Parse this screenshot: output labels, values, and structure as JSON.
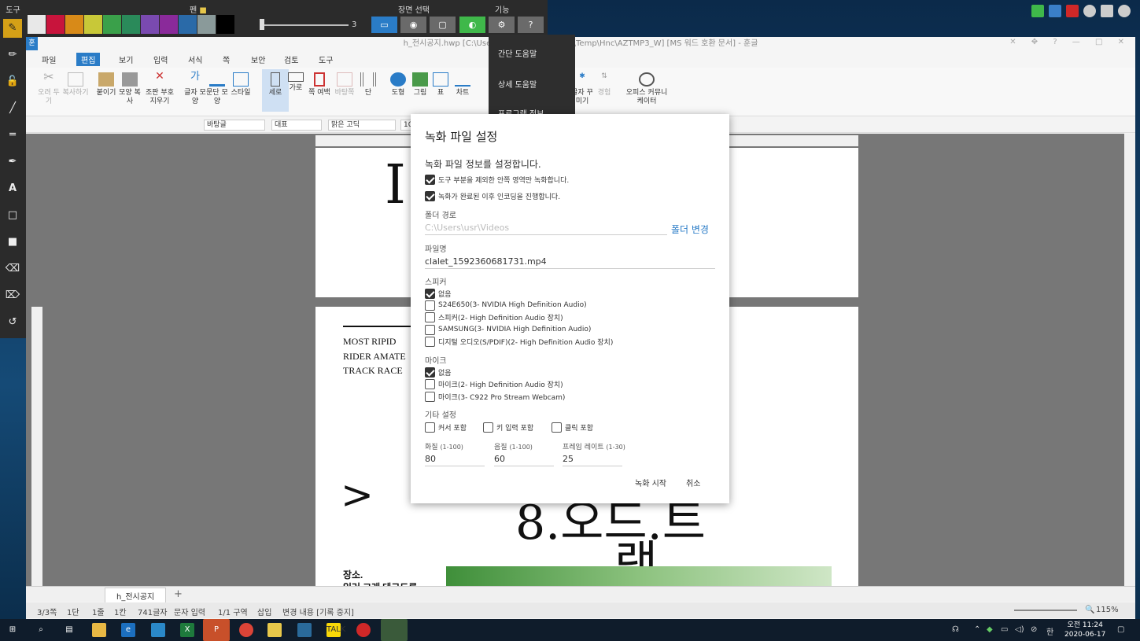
{
  "top_toolbar": {
    "tool_label": "도구",
    "pen_label": "펜",
    "screen_select_label": "장면 선택",
    "function_label": "기능",
    "pen_size": "3",
    "colors": [
      "#e8e8e8",
      "#c8143c",
      "#d88a18",
      "#c8c838",
      "#3aa04a",
      "#2a8a5a",
      "#7a4ab0",
      "#8a2a9a",
      "#2a6aa8",
      "#8a9a9a",
      "#000000"
    ]
  },
  "function_menu": {
    "items": [
      "간단 도움말",
      "상세 도움말",
      "프로그램 정보"
    ]
  },
  "app": {
    "title": "h_전시공지.hwp [C:\\Users\\usr\\AppData\\Local\\Temp\\Hnc\\AZTMP3_W] [MS 워드 호환 문서] - 훈글",
    "logo": "훈",
    "menu": [
      "파일",
      "편집",
      "보기",
      "입력",
      "서식",
      "쪽",
      "보안",
      "검토",
      "도구"
    ],
    "ribbon": [
      "오려 두기",
      "복사하기",
      "붙이기",
      "모양 복사",
      "조판 부호 지우기",
      "글자 모양",
      "문단 모양",
      "스타일",
      "세로",
      "가로",
      "쪽 여백",
      "바탕쪽",
      "단",
      "도형",
      "그림",
      "표",
      "차트",
      "글자 꾸미기",
      "경험",
      "오피스 커뮤니케이터"
    ],
    "style_select": "바탕글",
    "para_select": "대표",
    "font_select": "맑은 고딕",
    "size_select": "10"
  },
  "document": {
    "page1_big": "I          kS",
    "text_lines": [
      "MOST RIPID",
      "RIDER AMATE",
      "TRACK RACE"
    ],
    "arrow": ">",
    "big2": "8.오드.트",
    "big3": "랙",
    "place_lines": [
      "장소.",
      "일러 그래 테크도루"
    ]
  },
  "tabs": {
    "tab_name": "h_전시공지"
  },
  "status": {
    "page": "3/3쪽",
    "col": "1단",
    "line": "1줄",
    "cell": "1칸",
    "chars": "741글자",
    "mode": "문자 입력",
    "section": "1/1 구역",
    "insert": "삽입",
    "track": "변경 내용 [기록 중지]",
    "zoom": "115%"
  },
  "dialog": {
    "title": "녹화 파일 설정",
    "subtitle": "녹화 파일 정보를 설정합니다.",
    "opt1": "도구 부분을 제외한 안쪽 영역만 녹화합니다.",
    "opt2": "녹화가 완료된 이후 인코딩을 진행합니다.",
    "folder_label": "폴더 경로",
    "folder_path": "C:\\Users\\usr\\Videos",
    "folder_change": "폴더 변경",
    "filename_label": "파일명",
    "filename": "clalet_1592360681731.mp4",
    "speaker_label": "스피커",
    "speakers": [
      {
        "label": "없음",
        "checked": true
      },
      {
        "label": "S24E650(3- NVIDIA High Definition Audio)",
        "checked": false
      },
      {
        "label": "스피커(2- High Definition Audio 장치)",
        "checked": false
      },
      {
        "label": "SAMSUNG(3- NVIDIA High Definition Audio)",
        "checked": false
      },
      {
        "label": "디지털 오디오(S/PDIF)(2- High Definition Audio 장치)",
        "checked": false
      }
    ],
    "mic_label": "마이크",
    "mics": [
      {
        "label": "없음",
        "checked": true
      },
      {
        "label": "마이크(2- High Definition Audio 장치)",
        "checked": false
      },
      {
        "label": "마이크(3- C922 Pro Stream Webcam)",
        "checked": false
      }
    ],
    "etc_label": "기타 설정",
    "etc": [
      "커서 포함",
      "키 입력 포함",
      "클릭 포함"
    ],
    "quality_label": "화질",
    "quality_range": "(1-100)",
    "quality": "80",
    "sound_label": "음질",
    "sound_range": "(1-100)",
    "sound": "60",
    "fps_label": "프레임 레이트",
    "fps_range": "(1-30)",
    "fps": "25",
    "start": "녹화 시작",
    "cancel": "취소"
  },
  "taskbar": {
    "clock_time": "오전 11:24",
    "clock_date": "2020-06-17",
    "ime": "한"
  }
}
